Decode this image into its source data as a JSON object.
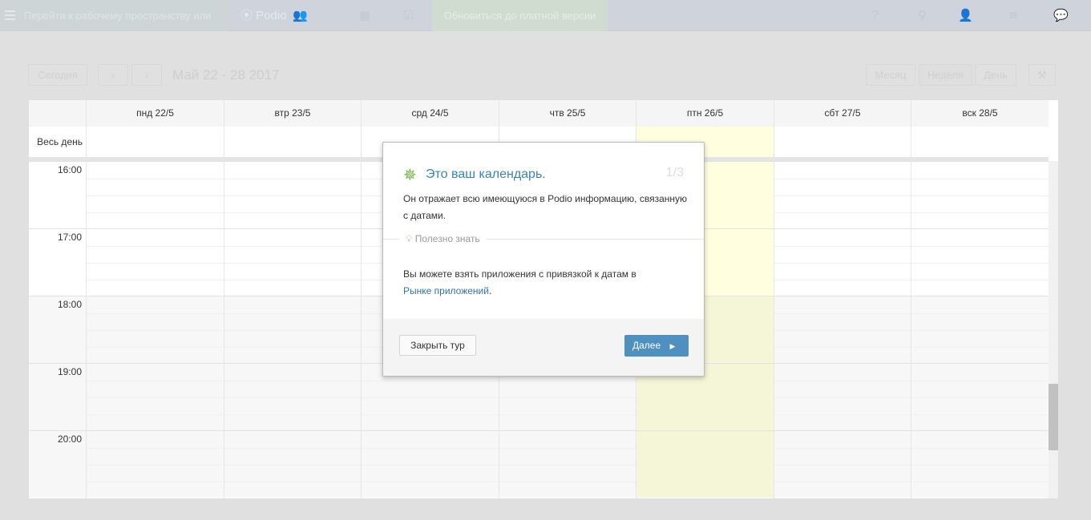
{
  "topbar": {
    "workspace_label": "Перейти к рабочему пространству или",
    "logo": "Podio",
    "upgrade_label": "Обновиться до платной версии"
  },
  "toolbar": {
    "today": "Сегодня",
    "prev": "‹",
    "next": "›",
    "date_range": "Май 22 - 28 2017",
    "month": "Месяц",
    "week": "Неделя",
    "day": "День"
  },
  "calendar": {
    "all_day_label": "Весь день",
    "days": [
      "пнд 22/5",
      "втр 23/5",
      "срд 24/5",
      "чтв 25/5",
      "птн 26/5",
      "сбт 27/5",
      "вск 28/5"
    ],
    "hours": [
      "16:00",
      "17:00",
      "18:00",
      "19:00",
      "20:00"
    ],
    "today_index": 4,
    "today_color": "#ffffe0"
  },
  "tour": {
    "title": "Это ваш календарь.",
    "step": "1/3",
    "text": "Он отражает всю имеющуюся в Podio информацию, связанную с датами.",
    "tip_label": "Полезно знать",
    "tip_text": "Вы можете взять приложения с привязкой к датам в ",
    "tip_link": "Рынке приложений",
    "tip_end": ".",
    "close_label": "Закрыть тур",
    "next_label": "Далее"
  }
}
